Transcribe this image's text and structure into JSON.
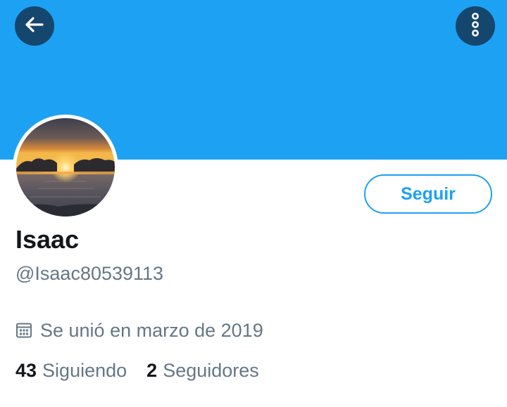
{
  "header": {
    "back_icon": "arrow-left-icon",
    "more_icon": "more-vertical-icon",
    "banner_color": "#1da1f2"
  },
  "profile": {
    "avatar": "sunset-over-sea-photo",
    "follow_label": "Seguir",
    "name": "Isaac",
    "handle": "@Isaac80539113",
    "joined_icon": "calendar-icon",
    "joined": "Se unió en marzo de 2019",
    "following_count": "43",
    "following_label": "Siguiendo",
    "followers_count": "2",
    "followers_label": "Seguidores"
  },
  "colors": {
    "accent": "#1da1f2",
    "text_primary": "#14171a",
    "text_secondary": "#657786"
  }
}
